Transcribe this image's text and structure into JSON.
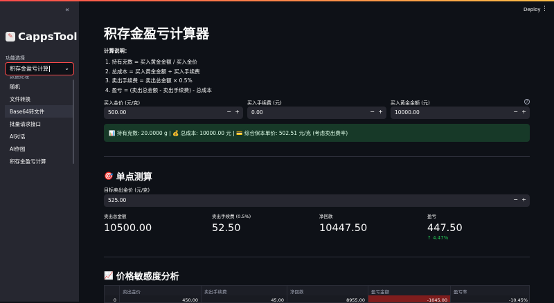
{
  "sidebar": {
    "collapse_icon": "«",
    "app_name": "CappsTool",
    "func_label": "功能选择",
    "selected": "积存金盈亏计算",
    "dropdown_clipped": "数据处理",
    "options": [
      "随机",
      "文件转换",
      "Base64转文件",
      "批量请求接口",
      "AI对话",
      "AI作图",
      "积存金盈亏计算"
    ]
  },
  "header": {
    "deploy": "Deploy",
    "menu_icon": "⋮"
  },
  "page": {
    "title": "积存金盈亏计算器",
    "explain_title": "计算说明：",
    "steps": [
      "1. 持有克数 = 买入黄金金额 / 买入金价",
      "2. 总成本 = 买入黄金金额 + 买入手续费",
      "3. 卖出手续费 = 卖出总金额 × 0.5%",
      "4. 盈亏 = (卖出总金额 - 卖出手续费) - 总成本"
    ]
  },
  "inputs": {
    "buy_price": {
      "label": "买入金价 (元/克)",
      "value": "500.00"
    },
    "buy_fee": {
      "label": "买入手续费 (元)",
      "value": "0.00"
    },
    "buy_amount": {
      "label": "买入黄金金额 (元)",
      "value": "10000.00"
    },
    "help_icon": "?"
  },
  "info_text": "📊 持有克数: 20.0000 g | 💰 总成本: 10000.00 元 | 💳 综合保本单价: 502.51 元/克 (考虑卖出费率)",
  "single": {
    "icon": "🎯",
    "title": "单点测算",
    "sell_label": "目标卖出金价 (元/克)",
    "sell_value": "525.00",
    "metrics": [
      {
        "label": "卖出总金额",
        "value": "10500.00"
      },
      {
        "label": "卖出手续费 (0.5%)",
        "value": "52.50"
      },
      {
        "label": "净回款",
        "value": "10447.50"
      },
      {
        "label": "盈亏",
        "value": "447.50"
      }
    ],
    "delta": "↑ 4.47%"
  },
  "sensitivity": {
    "icon": "📈",
    "title": "价格敏感度分析",
    "columns": [
      "",
      "卖出金价",
      "卖出手续费",
      "净回款",
      "盈亏金额",
      "盈亏率"
    ],
    "first_row": [
      "0",
      "450.00",
      "45.00",
      "8955.00",
      "-1045.00",
      "-10.45%"
    ]
  },
  "colors": {
    "accent": "#ff4b4b",
    "positive": "#21c354",
    "info_bg": "#173928",
    "loss_cell": "#7f1d1d"
  }
}
